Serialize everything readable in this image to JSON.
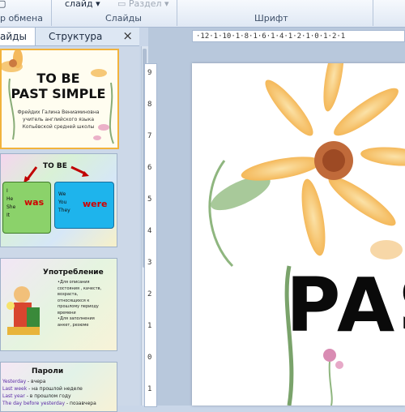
{
  "ribbon": {
    "clipboard_label": "р обмена",
    "slides_label": "Слайды",
    "font_label": "Шрифт",
    "layout_button": "слайд",
    "section_button": "Раздел"
  },
  "panel": {
    "tab_slides": "айды",
    "tab_outline": "Структура",
    "close": "×"
  },
  "thumbnails": [
    {
      "title1": "TO BE",
      "title2": "PAST SIMPLE",
      "author1": "Фрейдих Галина Вениаминовна",
      "author2": "учитель английского языка",
      "author3": "Копьёвской средней школы"
    },
    {
      "title": "TO BE",
      "left_words": [
        "I",
        "He",
        "She",
        "It"
      ],
      "left_verb": "was",
      "right_words": [
        "We",
        "You",
        "They"
      ],
      "right_verb": "were"
    },
    {
      "title": "Употребление",
      "lines": [
        "•Для описания",
        "состояния , качеств,",
        "возраста,",
        "относящихся к",
        "прошлому периоду",
        "времени",
        "•Для заполнения",
        "анкет, резюме"
      ]
    },
    {
      "title": "Пароли",
      "rows": [
        {
          "k": "Yesterday",
          "v": " - вчера"
        },
        {
          "k": "Last week",
          "v": " - на прошлой неделе"
        },
        {
          "k": "Last year",
          "v": " - в прошлом году"
        },
        {
          "k": "The day before yesterday",
          "v": " - позавчера"
        }
      ]
    }
  ],
  "ruler_h": "·12·1·10·1·8·1·6·1·4·1·2·1·0·1·2·1",
  "ruler_v": [
    "9",
    "8",
    "7",
    "6",
    "5",
    "4",
    "3",
    "2",
    "1",
    "0",
    "1"
  ],
  "slide": {
    "text": "PAS"
  },
  "colors": {
    "accent": "#f2b33c",
    "was": "#d00000",
    "were": "#d00000"
  }
}
